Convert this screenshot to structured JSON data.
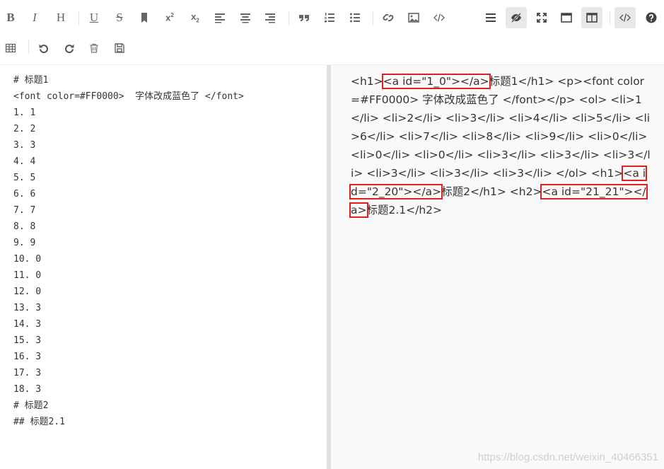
{
  "toolbar": {
    "row1": [
      {
        "name": "bold-button",
        "glyph": "B"
      },
      {
        "name": "italic-button",
        "glyph": "I"
      },
      {
        "name": "heading-button",
        "glyph": "H"
      },
      {
        "name": "underline-button",
        "glyph": "U"
      },
      {
        "name": "strikethrough-button",
        "glyph": "S"
      },
      {
        "name": "bookmark-button",
        "icon": "bookmark-icon"
      },
      {
        "name": "superscript-button",
        "glyph": "x²"
      },
      {
        "name": "subscript-button",
        "glyph": "x₂"
      },
      {
        "name": "align-left-button",
        "icon": "align-left-icon"
      },
      {
        "name": "align-center-button",
        "icon": "align-center-icon"
      },
      {
        "name": "align-right-button",
        "icon": "align-right-icon"
      },
      {
        "name": "quote-button",
        "icon": "quote-icon"
      },
      {
        "name": "ordered-list-button",
        "icon": "ordered-list-icon"
      },
      {
        "name": "unordered-list-button",
        "icon": "unordered-list-icon"
      },
      {
        "name": "link-button",
        "icon": "link-icon"
      },
      {
        "name": "image-button",
        "icon": "image-icon"
      },
      {
        "name": "code-button",
        "icon": "code-icon"
      },
      {
        "name": "navigation-button",
        "icon": "menu-icon"
      },
      {
        "name": "preview-toggle-button",
        "icon": "eye-slash-icon",
        "active": true
      },
      {
        "name": "fullscreen-button",
        "icon": "expand-icon"
      },
      {
        "name": "window-button",
        "icon": "window-icon"
      },
      {
        "name": "split-view-button",
        "icon": "columns-icon",
        "active": true
      },
      {
        "name": "html-code-button",
        "icon": "code-icon",
        "active": true
      },
      {
        "name": "help-button",
        "icon": "question-circle-icon"
      }
    ],
    "row2": [
      {
        "name": "table-button",
        "icon": "table-icon"
      },
      {
        "name": "undo-button",
        "icon": "undo-icon"
      },
      {
        "name": "redo-button",
        "icon": "redo-icon"
      },
      {
        "name": "trash-button",
        "icon": "trash-icon"
      },
      {
        "name": "save-button",
        "icon": "save-icon"
      }
    ]
  },
  "editor": {
    "lines": [
      "# 标题1",
      "<font color=#FF0000>  字体改成蓝色了 </font>",
      "1. 1",
      "2. 2",
      "3. 3",
      "4. 4",
      "5. 5",
      "6. 6",
      "7. 7",
      "8. 8",
      "9. 9",
      "10. 0",
      "11. 0",
      "12. 0",
      "13. 3",
      "14. 3",
      "15. 3",
      "16. 3",
      "17. 3",
      "18. 3",
      "# 标题2",
      "## 标题2.1"
    ]
  },
  "preview": {
    "segments": [
      {
        "text": "<h1>",
        "highlight": false
      },
      {
        "text": "<a id=\"1_0\"></a>",
        "highlight": true
      },
      {
        "text": "标题1</h1> <p><font color=#FF0000> 字体改成蓝色了 </font></p> <ol> <li>1</li> <li>2</li> <li>3</li> <li>4</li> <li>5</li> <li>6</li> <li>7</li> <li>8</li> <li>9</li> <li>0</li> <li>0</li> <li>0</li> <li>3</li> <li>3</li> <li>3</li> <li>3</li> <li>3</li> <li>3</li> </ol> <h1>",
        "highlight": false
      },
      {
        "text": "<a id=\"2_20\"></a>",
        "highlight": true
      },
      {
        "text": "标题2</h1> <h2>",
        "highlight": false
      },
      {
        "text": "<a id=\"21_21\"></a>",
        "highlight": true
      },
      {
        "text": "标题2.1</h2>",
        "highlight": false
      }
    ],
    "highlight_color": "#E02020"
  },
  "watermark": "https://blog.csdn.net/weixin_40466351"
}
